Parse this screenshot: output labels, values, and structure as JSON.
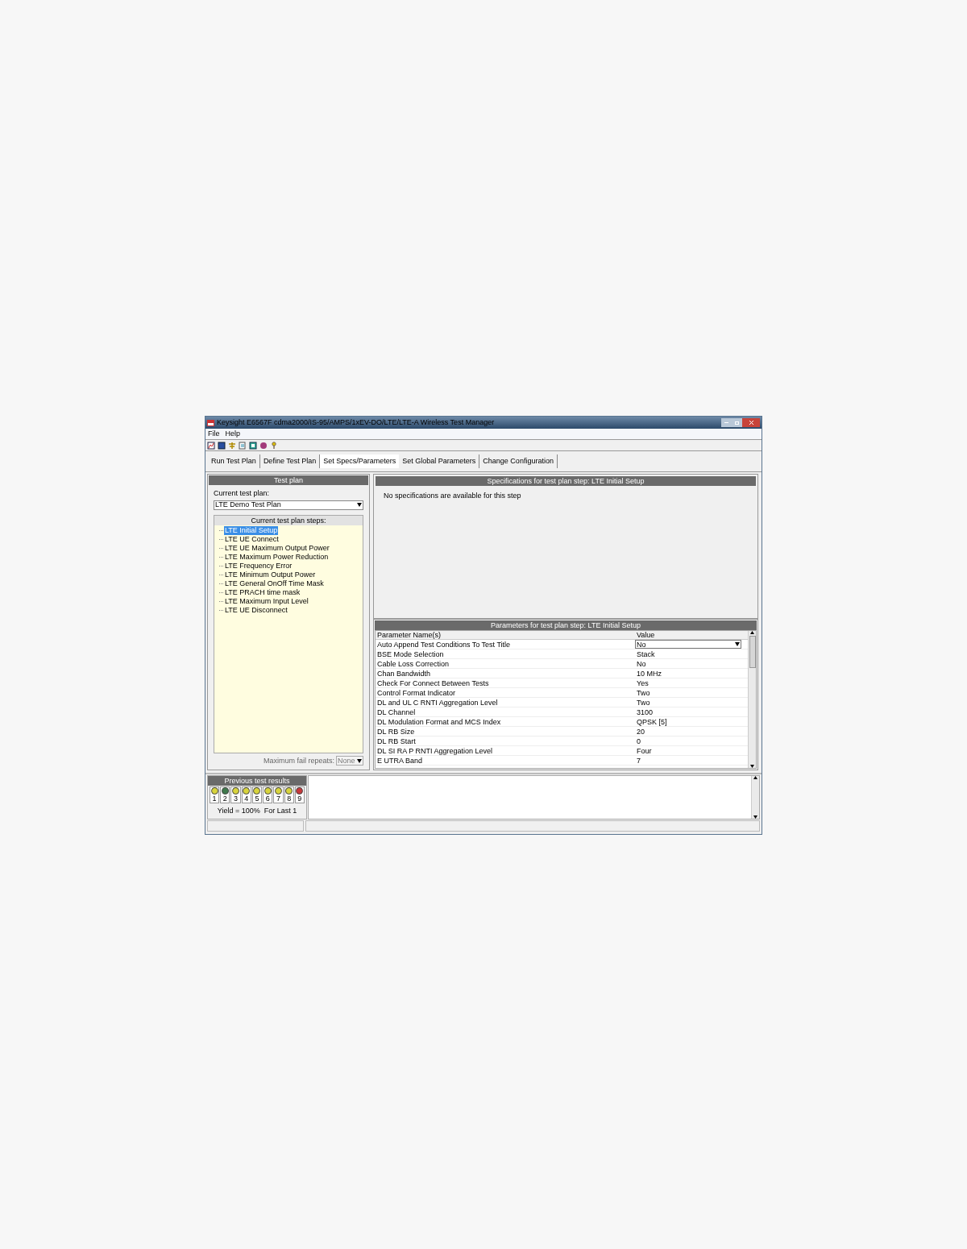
{
  "window": {
    "title": "Keysight E6567F cdma2000/IS-95/AMPS/1xEV-DO/LTE/LTE-A Wireless Test Manager"
  },
  "menu": [
    "File",
    "Help"
  ],
  "tabs": [
    {
      "label": "Run Test Plan",
      "selected": false
    },
    {
      "label": "Define Test Plan",
      "selected": false
    },
    {
      "label": "Set Specs/Parameters",
      "selected": true
    },
    {
      "label": "Set Global Parameters",
      "selected": false
    },
    {
      "label": "Change Configuration",
      "selected": false
    }
  ],
  "test_plan": {
    "title": "Test plan",
    "current_label": "Current test plan:",
    "current_value": "LTE Demo Test Plan",
    "steps_title": "Current test plan steps:",
    "steps": [
      {
        "label": "LTE Initial Setup",
        "selected": true
      },
      {
        "label": "LTE UE Connect",
        "selected": false
      },
      {
        "label": "LTE UE Maximum Output Power",
        "selected": false
      },
      {
        "label": "LTE Maximum Power Reduction",
        "selected": false
      },
      {
        "label": "LTE Frequency Error",
        "selected": false
      },
      {
        "label": "LTE Minimum Output Power",
        "selected": false
      },
      {
        "label": "LTE General OnOff Time Mask",
        "selected": false
      },
      {
        "label": "LTE PRACH time mask",
        "selected": false
      },
      {
        "label": "LTE Maximum Input Level",
        "selected": false
      },
      {
        "label": "LTE UE Disconnect",
        "selected": false
      }
    ],
    "fail_repeats_label": "Maximum fail repeats:",
    "fail_repeats_value": "None"
  },
  "specifications": {
    "title": "Specifications for test plan step: LTE Initial Setup",
    "message": "No specifications are available for this step"
  },
  "parameters": {
    "title": "Parameters for test plan step: LTE Initial Setup",
    "columns": [
      "Parameter Name(s)",
      "Value"
    ],
    "rows": [
      {
        "name": "Auto Append Test Conditions To Test Title",
        "value": "No",
        "kind": "dropdown"
      },
      {
        "name": "BSE Mode Selection",
        "value": "Stack",
        "kind": "text"
      },
      {
        "name": "Cable Loss Correction",
        "value": "No",
        "kind": "text"
      },
      {
        "name": "Chan Bandwidth",
        "value": "10 MHz",
        "kind": "text"
      },
      {
        "name": "Check For Connect Between Tests",
        "value": "Yes",
        "kind": "text"
      },
      {
        "name": "Control Format Indicator",
        "value": "Two",
        "kind": "text"
      },
      {
        "name": "DL and UL C RNTI Aggregation Level",
        "value": "Two",
        "kind": "text"
      },
      {
        "name": "DL Channel",
        "value": "3100",
        "kind": "text"
      },
      {
        "name": "DL Modulation Format and MCS Index",
        "value": "QPSK [5]",
        "kind": "text"
      },
      {
        "name": "DL RB Size",
        "value": "20",
        "kind": "text"
      },
      {
        "name": "DL RB Start",
        "value": "0",
        "kind": "text"
      },
      {
        "name": "DL SI RA P RNTI Aggregation Level",
        "value": "Four",
        "kind": "text"
      },
      {
        "name": "E UTRA Band",
        "value": "7",
        "kind": "text"
      }
    ]
  },
  "results": {
    "title": "Previous test results",
    "lights": [
      {
        "label": "1",
        "color": "#d8d43c"
      },
      {
        "label": "2",
        "color": "#3f7a4c"
      },
      {
        "label": "3",
        "color": "#d8d43c"
      },
      {
        "label": "4",
        "color": "#d8d43c"
      },
      {
        "label": "5",
        "color": "#d8d43c"
      },
      {
        "label": "6",
        "color": "#d8d43c"
      },
      {
        "label": "7",
        "color": "#d8d43c"
      },
      {
        "label": "8",
        "color": "#d8d43c"
      },
      {
        "label": "9",
        "color": "#c8383a"
      }
    ],
    "yield": "Yield = 100%  For Last 1"
  }
}
